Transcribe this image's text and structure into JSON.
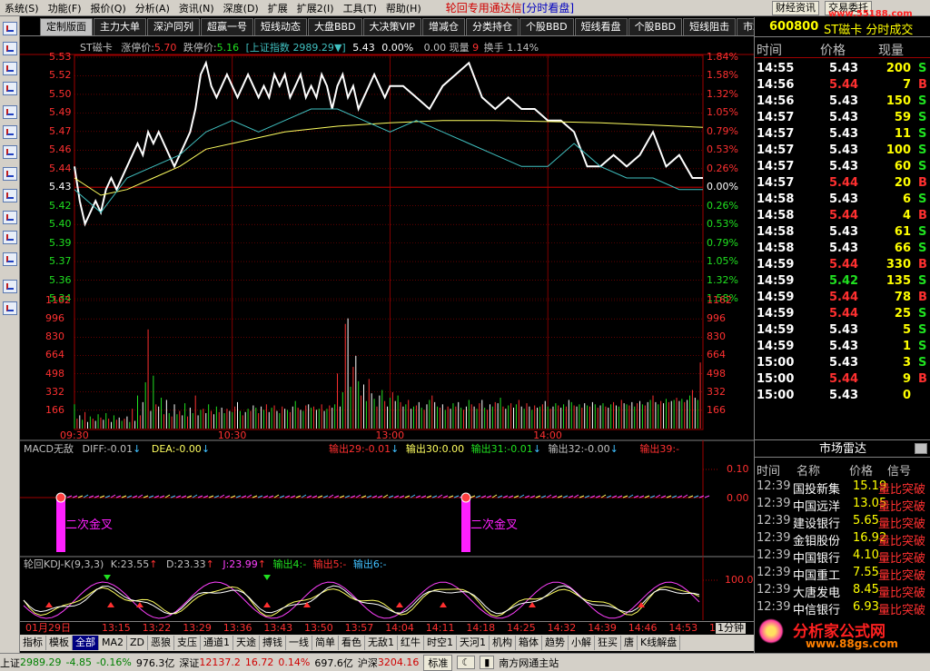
{
  "menu": {
    "items": [
      "系统(S)",
      "功能(F)",
      "报价(Q)",
      "分析(A)",
      "资讯(N)",
      "深度(D)",
      "扩展",
      "扩展2(I)",
      "工具(T)",
      "帮助(H)"
    ],
    "app_title": "轮回专用通达信",
    "app_mode": "[分时看盘]",
    "btn_news": "财经资讯",
    "btn_trade": "交易委托",
    "watermark_top": "www.55188.com"
  },
  "tabs": [
    "定制版面",
    "主力大单",
    "深沪同列",
    "超赢一号",
    "短线动态",
    "大盘BBD",
    "大决策VIP",
    "增减仓",
    "分类持仓",
    "个股BBD",
    "短线看盘",
    "个股BBD",
    "短线阻击",
    "市场雷达"
  ],
  "price_header": {
    "name": "ST磁卡",
    "limit_up_label": "涨停价:",
    "limit_up": "5.70",
    "limit_down_label": "跌停价:",
    "limit_down": "5.16",
    "index_label": "[上证指数",
    "index_value": "2989.29",
    "index_arrow": "▼]",
    "price": "5.43",
    "pct": "0.00%",
    "vol_text": "0.00 现量",
    "vol_now": "9",
    "turnover": "换手 1.14%"
  },
  "price_left_labels": [
    "5.53",
    "5.52",
    "5.50",
    "5.49",
    "5.47",
    "5.46",
    "5.44",
    "5.43",
    "5.42",
    "5.40",
    "5.39",
    "5.37",
    "5.36",
    "5.34"
  ],
  "price_right_labels": [
    "1.84%",
    "1.58%",
    "1.32%",
    "1.05%",
    "0.79%",
    "0.53%",
    "0.26%",
    "0.00%",
    "0.26%",
    "0.53%",
    "0.79%",
    "1.05%",
    "1.32%",
    "1.58%"
  ],
  "vol_labels": [
    "1162",
    "996",
    "830",
    "664",
    "498",
    "332",
    "166"
  ],
  "time_labels": [
    "09:30",
    "10:30",
    "13:00",
    "14:00"
  ],
  "chart_data": {
    "type": "line",
    "title": "ST磁卡 分时",
    "price_ylim": [
      5.325,
      5.535
    ],
    "base_price": 5.43,
    "vol_ylim": [
      0,
      1162
    ],
    "minutes": 240,
    "price_series": [
      {
        "name": "price",
        "x": [
          0,
          2,
          4,
          6,
          8,
          10,
          12,
          14,
          16,
          18,
          20,
          22,
          24,
          26,
          28,
          30,
          32,
          34,
          36,
          38,
          40,
          42,
          44,
          46,
          48,
          50,
          52,
          54,
          56,
          58,
          60,
          62,
          64,
          66,
          68,
          70,
          72,
          74,
          76,
          78,
          80,
          82,
          84,
          86,
          88,
          90,
          92,
          94,
          96,
          98,
          100,
          102,
          104,
          106,
          108,
          110,
          112,
          114,
          116,
          118,
          120,
          125,
          130,
          135,
          140,
          145,
          150,
          155,
          160,
          165,
          170,
          175,
          180,
          185,
          190,
          195,
          200,
          205,
          210,
          215,
          220,
          225,
          230,
          235,
          239
        ],
        "y": [
          5.44,
          5.41,
          5.39,
          5.4,
          5.41,
          5.4,
          5.42,
          5.43,
          5.42,
          5.43,
          5.44,
          5.45,
          5.46,
          5.45,
          5.47,
          5.46,
          5.47,
          5.46,
          5.45,
          5.44,
          5.45,
          5.46,
          5.47,
          5.49,
          5.52,
          5.53,
          5.51,
          5.5,
          5.51,
          5.52,
          5.51,
          5.5,
          5.51,
          5.52,
          5.51,
          5.5,
          5.51,
          5.5,
          5.52,
          5.51,
          5.52,
          5.5,
          5.51,
          5.52,
          5.5,
          5.51,
          5.5,
          5.52,
          5.51,
          5.49,
          5.51,
          5.52,
          5.5,
          5.51,
          5.49,
          5.5,
          5.51,
          5.52,
          5.51,
          5.5,
          5.51,
          5.51,
          5.5,
          5.49,
          5.51,
          5.52,
          5.53,
          5.5,
          5.49,
          5.5,
          5.49,
          5.49,
          5.48,
          5.48,
          5.47,
          5.44,
          5.44,
          5.45,
          5.44,
          5.45,
          5.47,
          5.44,
          5.45,
          5.43,
          5.43
        ]
      },
      {
        "name": "avg",
        "x": [
          0,
          10,
          20,
          30,
          40,
          50,
          60,
          80,
          100,
          120,
          140,
          160,
          180,
          200,
          220,
          239
        ],
        "y": [
          5.43,
          5.415,
          5.42,
          5.43,
          5.44,
          5.455,
          5.46,
          5.47,
          5.475,
          5.478,
          5.48,
          5.48,
          5.479,
          5.478,
          5.476,
          5.474
        ]
      },
      {
        "name": "index",
        "x": [
          0,
          10,
          20,
          30,
          40,
          50,
          60,
          70,
          80,
          90,
          100,
          110,
          120,
          130,
          140,
          150,
          160,
          170,
          180,
          190,
          200,
          210,
          220,
          230,
          239
        ],
        "y": [
          5.42,
          5.4,
          5.43,
          5.44,
          5.45,
          5.47,
          5.48,
          5.47,
          5.48,
          5.49,
          5.49,
          5.48,
          5.47,
          5.48,
          5.47,
          5.46,
          5.45,
          5.44,
          5.44,
          5.46,
          5.44,
          5.43,
          5.43,
          5.42,
          5.42
        ]
      }
    ],
    "volume": [
      220,
      90,
      120,
      80,
      150,
      60,
      110,
      90,
      70,
      130,
      100,
      80,
      140,
      90,
      60,
      120,
      80,
      100,
      70,
      90,
      110,
      60,
      180,
      70,
      300,
      120,
      240,
      420,
      900,
      160,
      480,
      220,
      200,
      280,
      130,
      260,
      140,
      110,
      220,
      130,
      160,
      120,
      230,
      110,
      190,
      140,
      300,
      120,
      170,
      180,
      140,
      220,
      160,
      130,
      200,
      150,
      190,
      140,
      180,
      160,
      150,
      200,
      240,
      160,
      120,
      150,
      180,
      160,
      210,
      190,
      140,
      200,
      170,
      220,
      150,
      190,
      210,
      160,
      140,
      200,
      180,
      170,
      150,
      200,
      250,
      190,
      170,
      160,
      210,
      220,
      190,
      200,
      170,
      180,
      220,
      160,
      180,
      210,
      190,
      220,
      500,
      200,
      330,
      950,
      1000,
      380,
      560,
      660,
      430,
      300,
      400,
      250,
      450,
      320,
      270,
      200,
      300,
      350,
      250,
      200,
      280,
      330,
      250,
      300,
      240,
      200,
      220,
      260,
      180,
      200,
      210,
      240,
      190,
      170,
      220,
      260,
      300,
      240,
      200,
      190,
      220,
      170,
      200,
      180,
      230,
      200,
      240,
      190,
      170,
      200,
      260,
      220,
      200,
      180,
      230,
      260,
      190,
      170,
      220,
      200,
      240,
      230,
      280,
      200,
      180,
      210,
      230,
      190,
      220,
      260,
      200,
      180,
      230,
      200,
      170,
      210,
      190,
      200,
      220,
      250,
      200,
      180,
      200,
      230,
      210,
      190,
      220,
      200,
      260,
      240,
      210,
      200,
      220,
      190,
      230,
      210,
      200,
      240,
      220,
      190,
      210,
      230,
      200,
      190,
      220,
      240,
      210,
      200,
      260,
      230,
      220,
      210,
      240,
      200,
      230,
      250,
      220,
      210,
      240,
      260,
      300,
      240,
      220,
      250,
      230,
      270,
      240,
      250,
      260,
      280,
      250,
      270,
      240,
      260,
      300,
      350,
      280,
      260,
      600
    ]
  },
  "macd": {
    "label": "MACD无敌",
    "diff": "DIFF:-0.01",
    "dea": "DEA:-0.00",
    "out29": "输出29:-0.01",
    "out30": "输出30:0.00",
    "out31": "输出31:-0.01",
    "out32": "输出32:-0.00",
    "out39": "输出39:-",
    "axis_hi": "0.10",
    "axis_zero": "0.00",
    "signal_text": "二次金叉"
  },
  "kdj": {
    "label": "轮回KDJ-K(9,3,3)",
    "k": "K:23.55",
    "d": "D:23.33",
    "j": "J:23.99",
    "out4": "输出4:-",
    "out5": "输出5:-",
    "out6": "输出6:-",
    "axis_hi": "100.0"
  },
  "bottom_times": [
    "01月29日",
    "13:15",
    "13:22",
    "13:29",
    "13:36",
    "13:43",
    "13:50",
    "13:57",
    "14:04",
    "14:11",
    "14:18",
    "14:25",
    "14:32",
    "14:39",
    "14:46",
    "14:53",
    "15:0"
  ],
  "period": "1分钟",
  "indicator_buttons": [
    "指标",
    "模板",
    "全部",
    "MA2",
    "ZD",
    "恶狼",
    "支压",
    "通道1",
    "天途",
    "搏钱",
    "一线",
    "简单",
    "看色",
    "无敌1",
    "红牛",
    "时空1",
    "天河1",
    "机构",
    "箱体",
    "趋势",
    "小解",
    "狂买",
    "唐",
    "K线解盘"
  ],
  "stock_panel": {
    "code": "600800",
    "name": "ST磁卡 分时成交",
    "col_time": "时间",
    "col_price": "价格",
    "col_vol": "现量",
    "trades": [
      {
        "time": "14:55",
        "price": "5.43",
        "vol": "200",
        "side": "S",
        "pc": "w",
        "sc": "g"
      },
      {
        "time": "14:56",
        "price": "5.44",
        "vol": "7",
        "side": "B",
        "pc": "r",
        "sc": "r"
      },
      {
        "time": "14:56",
        "price": "5.43",
        "vol": "150",
        "side": "S",
        "pc": "w",
        "sc": "g"
      },
      {
        "time": "14:57",
        "price": "5.43",
        "vol": "59",
        "side": "S",
        "pc": "w",
        "sc": "g"
      },
      {
        "time": "14:57",
        "price": "5.43",
        "vol": "11",
        "side": "S",
        "pc": "w",
        "sc": "g"
      },
      {
        "time": "14:57",
        "price": "5.43",
        "vol": "100",
        "side": "S",
        "pc": "w",
        "sc": "g"
      },
      {
        "time": "14:57",
        "price": "5.43",
        "vol": "60",
        "side": "S",
        "pc": "w",
        "sc": "g"
      },
      {
        "time": "14:57",
        "price": "5.44",
        "vol": "20",
        "side": "B",
        "pc": "r",
        "sc": "r"
      },
      {
        "time": "14:58",
        "price": "5.43",
        "vol": "6",
        "side": "S",
        "pc": "w",
        "sc": "g"
      },
      {
        "time": "14:58",
        "price": "5.44",
        "vol": "4",
        "side": "B",
        "pc": "r",
        "sc": "r"
      },
      {
        "time": "14:58",
        "price": "5.43",
        "vol": "61",
        "side": "S",
        "pc": "w",
        "sc": "g"
      },
      {
        "time": "14:58",
        "price": "5.43",
        "vol": "66",
        "side": "S",
        "pc": "w",
        "sc": "g"
      },
      {
        "time": "14:59",
        "price": "5.44",
        "vol": "330",
        "side": "B",
        "pc": "r",
        "sc": "r"
      },
      {
        "time": "14:59",
        "price": "5.42",
        "vol": "135",
        "side": "S",
        "pc": "g",
        "sc": "g"
      },
      {
        "time": "14:59",
        "price": "5.44",
        "vol": "78",
        "side": "B",
        "pc": "r",
        "sc": "r"
      },
      {
        "time": "14:59",
        "price": "5.44",
        "vol": "25",
        "side": "S",
        "pc": "r",
        "sc": "g"
      },
      {
        "time": "14:59",
        "price": "5.43",
        "vol": "5",
        "side": "S",
        "pc": "w",
        "sc": "g"
      },
      {
        "time": "14:59",
        "price": "5.43",
        "vol": "1",
        "side": "S",
        "pc": "w",
        "sc": "g"
      },
      {
        "time": "15:00",
        "price": "5.43",
        "vol": "3",
        "side": "S",
        "pc": "w",
        "sc": "g"
      },
      {
        "time": "15:00",
        "price": "5.44",
        "vol": "9",
        "side": "B",
        "pc": "r",
        "sc": "r"
      },
      {
        "time": "15:00",
        "price": "5.43",
        "vol": "0",
        "side": "",
        "pc": "w",
        "sc": "g"
      }
    ]
  },
  "radar": {
    "title": "市场雷达",
    "col_time": "时间",
    "col_name": "名称",
    "col_price": "价格",
    "col_signal": "信号",
    "rows": [
      {
        "time": "12:39",
        "name": "国投新集",
        "price": "15.19",
        "signal": "量比突破"
      },
      {
        "time": "12:39",
        "name": "中国远洋",
        "price": "13.05",
        "signal": "量比突破"
      },
      {
        "time": "12:39",
        "name": "建设银行",
        "price": "5.65",
        "signal": "量比突破"
      },
      {
        "time": "12:39",
        "name": "金钼股份",
        "price": "16.92",
        "signal": "量比突破"
      },
      {
        "time": "12:39",
        "name": "中国银行",
        "price": "4.10",
        "signal": "量比突破"
      },
      {
        "time": "12:39",
        "name": "中国重工",
        "price": "7.55",
        "signal": "量比突破"
      },
      {
        "time": "12:39",
        "name": "大唐发电",
        "price": "8.45",
        "signal": "量比突破"
      },
      {
        "time": "12:39",
        "name": "中信银行",
        "price": "6.93",
        "signal": "量比突破"
      }
    ],
    "watermark_cn": "分析家公式网",
    "watermark_url": "www.88gs.com"
  },
  "status": {
    "sh_label": "上证",
    "sh_val": "2989.29",
    "sh_chg": "-4.85",
    "sh_pct": "-0.16%",
    "sh_amt": "976.3亿",
    "sz_label": "深证",
    "sz_val": "12137.2",
    "sz_chg": "16.72",
    "sz_pct": "0.14%",
    "sz_amt": "697.6亿",
    "hs_label": "沪深",
    "hs_val": "3204.16",
    "std_btn": "标准",
    "site": "南方网通主站"
  },
  "colors": {
    "up": "#ff3030",
    "down": "#20e020",
    "price_line": "#ffffff",
    "avg_line": "#ffff60",
    "index_line": "#40c0c0",
    "grid_red": "#a00000",
    "magenta": "#ff20ff"
  }
}
